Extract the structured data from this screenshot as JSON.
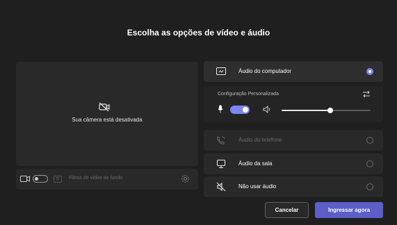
{
  "title": "Escolha as opções de vídeo e áudio",
  "preview": {
    "camera_off_text": "Sua câmera está desativada",
    "camera_icon": "camera-off-icon"
  },
  "camera_bar": {
    "camera_icon": "camera-icon",
    "toggle_state": "off",
    "effects_label": "Filtros de vídeo de fundo",
    "effects_icon": "background-effects-icon",
    "settings_icon": "gear-icon"
  },
  "audio": {
    "computer_audio": {
      "label": "Áudio do computador",
      "icon": "computer-audio-icon",
      "selected": true
    },
    "config": {
      "label": "Configuração Personalizada",
      "swap_icon": "swap-icon",
      "mic_on": true,
      "volume": 0.55
    },
    "phone_audio": {
      "label": "Áudio do telefone",
      "icon": "phone-audio-icon",
      "disabled": true
    },
    "room_audio": {
      "label": "Áudio da sala",
      "icon": "room-audio-icon"
    },
    "no_audio": {
      "label": "Não usar áudio",
      "icon": "no-audio-icon"
    }
  },
  "buttons": {
    "cancel_label": "Cancelar",
    "join_label": "Ingressar agora"
  },
  "colors": {
    "accent": "#5b5fc7",
    "toggle_on": "#7f85f5",
    "background": "#1f1f1f",
    "surface": "#292929"
  }
}
